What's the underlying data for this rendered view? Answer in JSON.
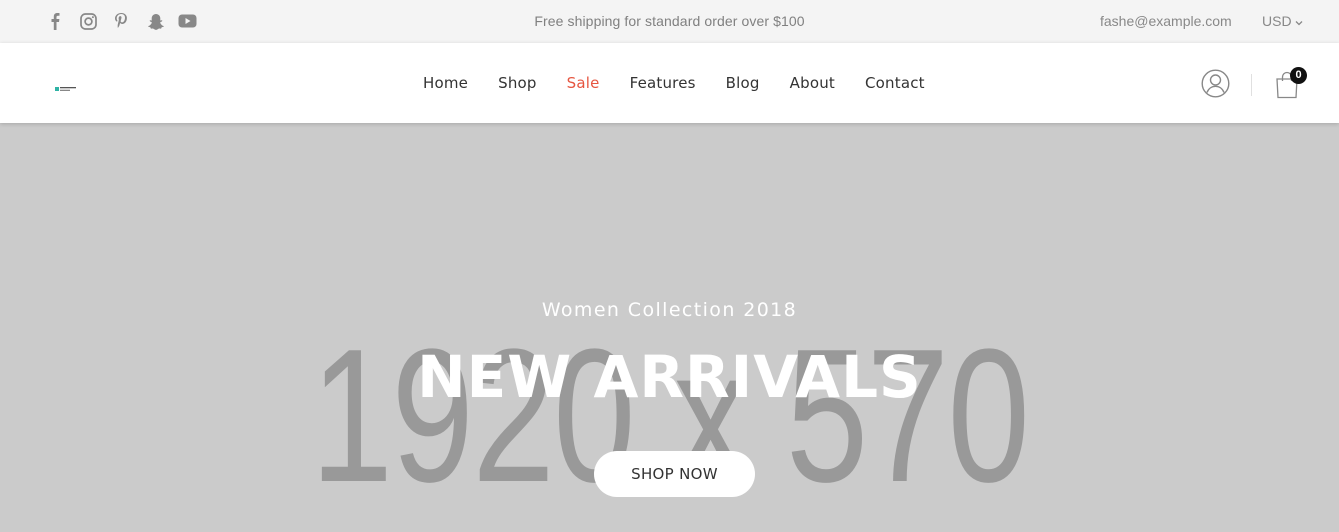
{
  "topbar": {
    "social_icons": [
      "facebook-icon",
      "instagram-icon",
      "pinterest-icon",
      "snapchat-icon",
      "youtube-icon"
    ],
    "promo_text": "Free shipping for standard order over $100",
    "email": "fashe@example.com",
    "currency": "USD"
  },
  "header": {
    "nav": [
      {
        "label": "Home"
      },
      {
        "label": "Shop"
      },
      {
        "label": "Sale",
        "active": true
      },
      {
        "label": "Features"
      },
      {
        "label": "Blog"
      },
      {
        "label": "About"
      },
      {
        "label": "Contact"
      }
    ],
    "cart_count": "0"
  },
  "hero": {
    "placeholder_text": "1920 x 570",
    "subtitle": "Women Collection 2018",
    "title": "NEW ARRIVALS",
    "button_label": "SHOP NOW"
  },
  "colors": {
    "accent": "#e65540",
    "topbar_bg": "#f4f4f4",
    "hero_bg": "#cbcbcb"
  }
}
